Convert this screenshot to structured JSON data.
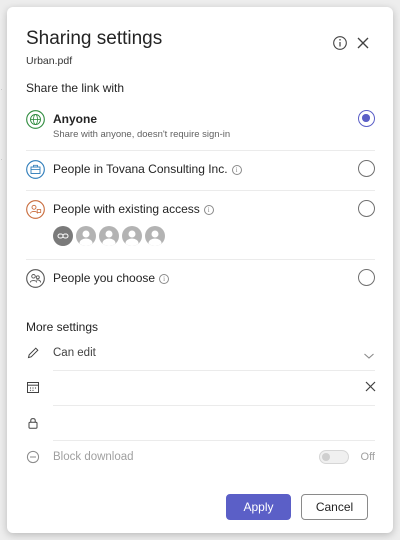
{
  "dialog": {
    "title": "Sharing settings",
    "file_name": "Urban.pdf",
    "info_icon": "info-icon",
    "close_icon": "close-icon"
  },
  "share_with": {
    "label": "Share the link with",
    "options": [
      {
        "id": "anyone",
        "title": "Anyone",
        "description": "Share with anyone, doesn't require sign-in",
        "icon": "globe-icon",
        "selected": true
      },
      {
        "id": "organization",
        "title": "People in Tovana Consulting Inc.",
        "icon": "organization-icon",
        "has_info": true,
        "selected": false
      },
      {
        "id": "existing",
        "title": "People with existing access",
        "icon": "people-existing-icon",
        "has_info": true,
        "selected": false
      },
      {
        "id": "choose",
        "title": "People you choose",
        "icon": "people-choose-icon",
        "has_info": true,
        "selected": false
      }
    ]
  },
  "more_settings": {
    "label": "More settings",
    "permission": {
      "value": "Can edit",
      "icon": "pencil-icon"
    },
    "expiration": {
      "icon": "calendar-icon",
      "value": ""
    },
    "password": {
      "icon": "lock-icon",
      "value": ""
    },
    "block_download": {
      "label": "Block download",
      "state_label": "Off",
      "enabled": false
    }
  },
  "buttons": {
    "apply": "Apply",
    "cancel": "Cancel"
  },
  "colors": {
    "accent": "#5b5fc7",
    "globe_green": "#2e8b3d",
    "org_blue": "#2b7bb9",
    "existing_orange": "#c86a3a"
  }
}
